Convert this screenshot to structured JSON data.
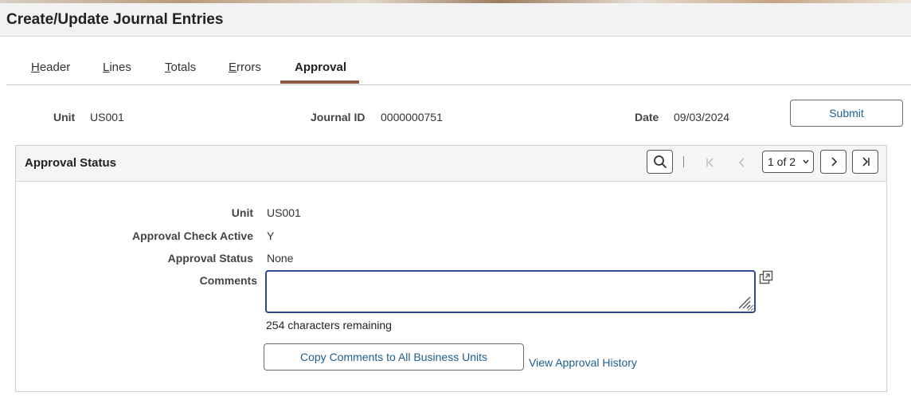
{
  "page": {
    "title": "Create/Update Journal Entries"
  },
  "tabs": [
    {
      "first": "H",
      "rest": "eader"
    },
    {
      "first": "L",
      "rest": "ines"
    },
    {
      "first": "T",
      "rest": "otals"
    },
    {
      "first": "E",
      "rest": "rrors"
    },
    {
      "label": "Approval",
      "active": true
    }
  ],
  "summary": {
    "unit_label": "Unit",
    "unit_value": "US001",
    "journal_label": "Journal ID",
    "journal_value": "0000000751",
    "date_label": "Date",
    "date_value": "09/03/2024",
    "submit_label": "Submit"
  },
  "panel": {
    "title": "Approval Status",
    "pager_value": "1 of 2",
    "icons": [
      "search-icon",
      "first-page-icon",
      "previous-page-icon",
      "next-page-icon",
      "last-page-icon"
    ],
    "fields": {
      "unit_label": "Unit",
      "unit_value": "US001",
      "check_label": "Approval Check Active",
      "check_value": "Y",
      "status_label": "Approval Status",
      "status_value": "None",
      "comments_label": "Comments",
      "comments_value": ""
    },
    "chars_remaining": "254 characters remaining",
    "copy_button": "Copy Comments to All Business Units",
    "history_link": "View Approval History"
  },
  "colors": {
    "accent": "#8a5a3a",
    "link": "#1f5f8f",
    "focus": "#2b4c8c"
  }
}
